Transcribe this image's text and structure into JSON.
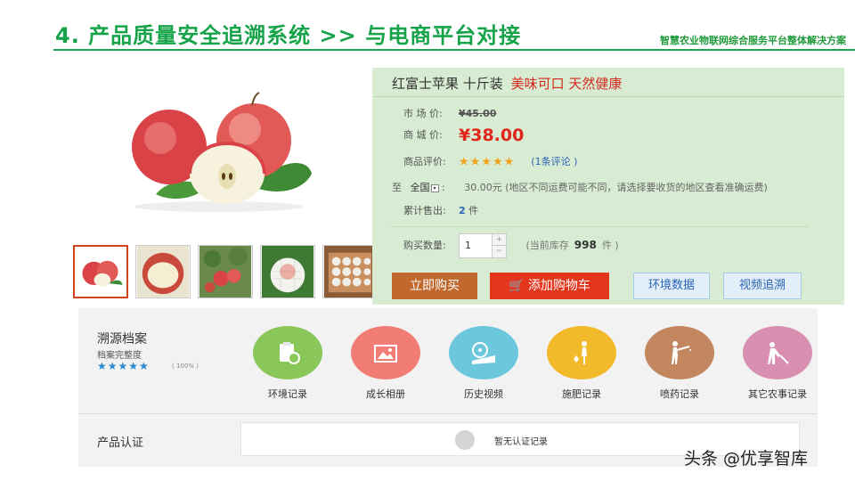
{
  "header": {
    "title": "4. 产品质量安全追溯系统 >> 与电商平台对接",
    "subtitle": "智慧农业物联网综合服务平台整体解决方案"
  },
  "product": {
    "name": "红富士苹果 十斤装",
    "slogan": "美味可口 天然健康",
    "market_price_label": "市 场 价:",
    "market_price": "¥45.00",
    "mall_price_label": "商 城 价:",
    "mall_price": "¥38.00",
    "rating_label": "商品评价:",
    "rating_stars": "★★★★★",
    "review_link": "(1条评论 )",
    "ship_to_label": "至",
    "ship_region": "全国",
    "ship_region_icon": "chevron-down-icon",
    "shipping_note": "30.00元 (地区不同运费可能不同，请选择要收货的地区查看准确运费)",
    "sold_label": "累计售出:",
    "sold_count": "2",
    "sold_unit": "件",
    "qty_label": "购买数量:",
    "qty_value": "1",
    "stock_prefix": "(当前库存",
    "stock_count": "998",
    "stock_suffix": "件 )",
    "thumbnails": [
      "apple-pair-thumb",
      "apple-cut-thumb",
      "apple-tree-thumb",
      "apple-wrapped-thumb",
      "apple-box-thumb"
    ]
  },
  "buttons": {
    "buy_now": "立即购买",
    "add_cart": "添加购物车",
    "env_data": "环境数据",
    "video_trace": "视频追溯"
  },
  "trace": {
    "title": "溯源档案",
    "completeness_label": "档案完整度",
    "stars": "★★★★★",
    "percent": "( 100% )",
    "items": [
      {
        "label": "环境记录",
        "color": "#8ac75a",
        "icon": "clipboard-icon"
      },
      {
        "label": "成长相册",
        "color": "#f27d77",
        "icon": "picture-frame-icon"
      },
      {
        "label": "历史视频",
        "color": "#6cc7dd",
        "icon": "film-reel-icon"
      },
      {
        "label": "施肥记录",
        "color": "#f2b92a",
        "icon": "fertilizer-person-icon"
      },
      {
        "label": "喷药记录",
        "color": "#c2875e",
        "icon": "spray-person-icon"
      },
      {
        "label": "其它农事记录",
        "color": "#d88fb1",
        "icon": "farm-work-icon"
      }
    ],
    "cert_label": "产品认证",
    "cert_empty": "暂无认证记录"
  },
  "watermark": "头条 @优享智库",
  "colors": {
    "brand_green": "#17a34a",
    "panel_bg": "#d7ecd2",
    "price_red": "#e0251b",
    "buy_button": "#c1682e",
    "cart_button": "#e3361c",
    "link_blue": "#2a63b8"
  }
}
